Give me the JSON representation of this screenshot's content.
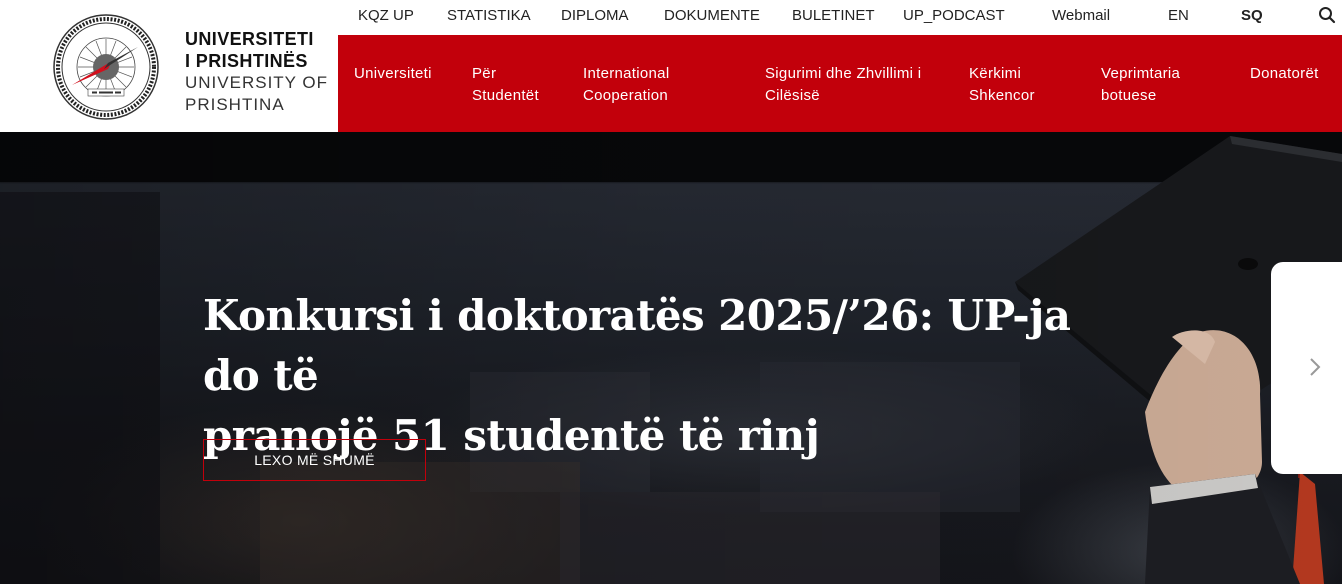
{
  "logo": {
    "line1": "UNIVERSITETI",
    "line2": "I PRISHTINËS",
    "line3": "UNIVERSITY OF",
    "line4": "PRISHTINA",
    "seal_icon": "university-seal-icon"
  },
  "topbar": {
    "items": [
      "KQZ UP",
      "STATISTIKA",
      "DIPLOMA",
      "DOKUMENTE",
      "BULETINET",
      "UP_PODCAST",
      "Webmail",
      "EN",
      "SQ"
    ],
    "active_language": "SQ",
    "search_icon": "search-icon"
  },
  "mainnav": {
    "items": [
      {
        "line1": "Universiteti",
        "line2": ""
      },
      {
        "line1": "Për",
        "line2": "Studentët"
      },
      {
        "line1": "International",
        "line2": "Cooperation"
      },
      {
        "line1": "Sigurimi dhe Zhvillimi i",
        "line2": "Cilësisë"
      },
      {
        "line1": "Kërkimi",
        "line2": "Shkencor"
      },
      {
        "line1": "Veprimtaria",
        "line2": "botuese"
      },
      {
        "line1": "Donatorët",
        "line2": ""
      }
    ]
  },
  "hero": {
    "title_line1": "Konkursi i doktoratës 2025/’26: UP-ja do të",
    "title_line2": "pranojë 51 studentë të rinj",
    "button": "LEXO MË SHUMË",
    "next_icon": "chevron-right-icon"
  },
  "colors": {
    "brand_red": "#c2000b",
    "white": "#ffffff",
    "hero_dark": "#14151a"
  }
}
